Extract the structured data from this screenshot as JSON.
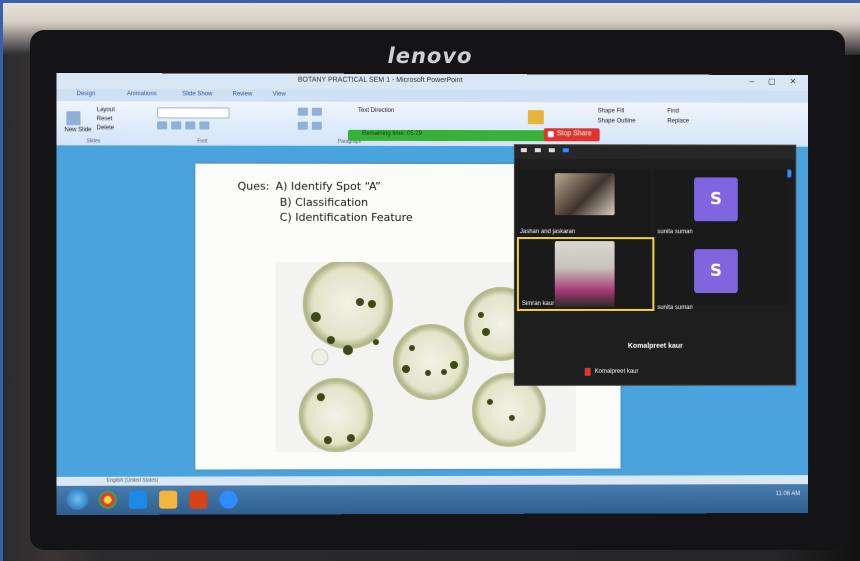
{
  "monitor": {
    "brand": "lenovo"
  },
  "powerpoint": {
    "window_title": "BOTANY PRACTICAL SEM 1 - Microsoft PowerPoint",
    "tabs": [
      "Design",
      "Animations",
      "Slide Show",
      "Review",
      "View"
    ],
    "ribbon": {
      "layout": "Layout",
      "reset": "Reset",
      "new_slide": "New Slide",
      "delete": "Delete",
      "text_direction": "Text Direction",
      "shape_fill": "Shape Fill",
      "shape_outline": "Shape Outline",
      "find": "Find",
      "replace": "Replace",
      "groups": [
        "Slides",
        "Font",
        "Paragraph"
      ]
    },
    "status_bar": "English (United States)"
  },
  "slide": {
    "question_label": "Ques:",
    "line1": "A) Identify Spot “A”",
    "line2": "B)  Classification",
    "line3": "C) Identification Feature"
  },
  "zoom": {
    "sharing_bar": "Remaining time: 05:29",
    "stop_share": "Stop Share",
    "participants": [
      {
        "name": "Jashan and jaskaran",
        "type": "video"
      },
      {
        "name": "sunita suman",
        "type": "avatar",
        "initial": "S"
      },
      {
        "name": "Simran kaur",
        "type": "video",
        "active": true
      },
      {
        "name": "sunita suman",
        "type": "avatar",
        "initial": "S"
      }
    ],
    "featured_name": "Komalpreet kaur",
    "bottom_name": "Komalpreet kaur",
    "colors": {
      "avatar": "#7f66e0",
      "active_border": "#f4d23d",
      "stop": "#e0342e"
    }
  },
  "taskbar": {
    "clock": "11:06 AM"
  }
}
